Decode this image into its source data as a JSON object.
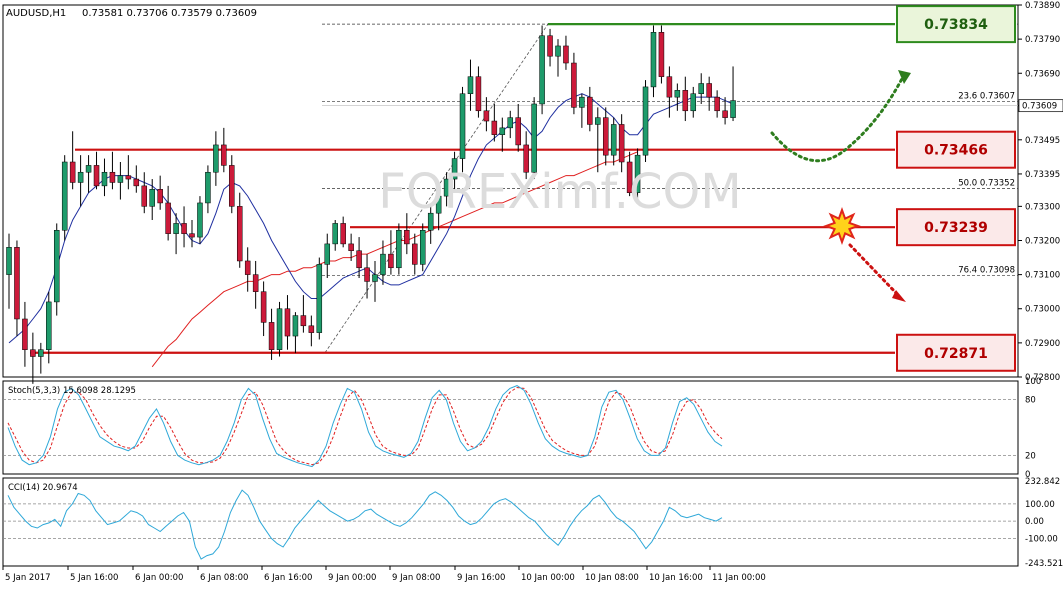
{
  "header": {
    "symbol": "AUDUSD,H1",
    "ohlc": "0.73581 0.73706 0.73579 0.73609"
  },
  "watermark": "FOREXimf.COM",
  "chart_data": [
    {
      "type": "candlestick",
      "ylim": [
        0.728,
        0.7389
      ],
      "y_ticks": [
        "0.73890",
        "0.73790",
        "0.73690",
        "0.73595",
        "0.73495",
        "0.73395",
        "0.73300",
        "0.73200",
        "0.73100",
        "0.73000",
        "0.72900",
        "0.72800"
      ],
      "current_price": "0.73609",
      "x_labels": [
        "5 Jan 2017",
        "5 Jan 16:00",
        "6 Jan 00:00",
        "6 Jan 08:00",
        "6 Jan 16:00",
        "9 Jan 00:00",
        "9 Jan 08:00",
        "9 Jan 16:00",
        "10 Jan 00:00",
        "10 Jan 08:00",
        "10 Jan 16:00",
        "11 Jan 00:00"
      ],
      "candles": [
        [
          0.731,
          0.7322,
          0.73,
          0.7318
        ],
        [
          0.7318,
          0.732,
          0.7292,
          0.7297
        ],
        [
          0.7297,
          0.7302,
          0.7283,
          0.7288
        ],
        [
          0.7288,
          0.7293,
          0.7278,
          0.7286
        ],
        [
          0.7286,
          0.729,
          0.7281,
          0.7288
        ],
        [
          0.7288,
          0.7305,
          0.7284,
          0.7302
        ],
        [
          0.7302,
          0.7325,
          0.7298,
          0.7323
        ],
        [
          0.7323,
          0.7345,
          0.732,
          0.7343
        ],
        [
          0.7343,
          0.7352,
          0.7335,
          0.7337
        ],
        [
          0.7337,
          0.7345,
          0.733,
          0.734
        ],
        [
          0.734,
          0.7345,
          0.7334,
          0.7342
        ],
        [
          0.7342,
          0.7346,
          0.7335,
          0.7336
        ],
        [
          0.7336,
          0.7344,
          0.7333,
          0.734
        ],
        [
          0.734,
          0.7346,
          0.7335,
          0.7337
        ],
        [
          0.7337,
          0.7343,
          0.7332,
          0.7339
        ],
        [
          0.7339,
          0.7345,
          0.7335,
          0.7338
        ],
        [
          0.7338,
          0.7342,
          0.7334,
          0.7336
        ],
        [
          0.7336,
          0.734,
          0.7328,
          0.733
        ],
        [
          0.733,
          0.7338,
          0.7326,
          0.7335
        ],
        [
          0.7335,
          0.7339,
          0.7329,
          0.7331
        ],
        [
          0.7331,
          0.7336,
          0.732,
          0.7322
        ],
        [
          0.7322,
          0.7328,
          0.7316,
          0.7325
        ],
        [
          0.7325,
          0.733,
          0.7318,
          0.7322
        ],
        [
          0.7322,
          0.7326,
          0.7318,
          0.7321
        ],
        [
          0.7321,
          0.7333,
          0.7319,
          0.7331
        ],
        [
          0.7331,
          0.7342,
          0.7328,
          0.734
        ],
        [
          0.734,
          0.7352,
          0.7336,
          0.7348
        ],
        [
          0.7348,
          0.7353,
          0.734,
          0.7342
        ],
        [
          0.7342,
          0.7345,
          0.7328,
          0.733
        ],
        [
          0.733,
          0.7334,
          0.7312,
          0.7314
        ],
        [
          0.7314,
          0.7318,
          0.7305,
          0.731
        ],
        [
          0.731,
          0.7314,
          0.73,
          0.7305
        ],
        [
          0.7305,
          0.7308,
          0.7292,
          0.7296
        ],
        [
          0.7296,
          0.73,
          0.7285,
          0.7288
        ],
        [
          0.7288,
          0.7302,
          0.7286,
          0.73
        ],
        [
          0.73,
          0.7304,
          0.7288,
          0.7292
        ],
        [
          0.7292,
          0.7299,
          0.7287,
          0.7298
        ],
        [
          0.7298,
          0.7304,
          0.7293,
          0.7295
        ],
        [
          0.7295,
          0.7298,
          0.7289,
          0.7293
        ],
        [
          0.7293,
          0.7315,
          0.7291,
          0.7313
        ],
        [
          0.7313,
          0.7322,
          0.7309,
          0.7319
        ],
        [
          0.7319,
          0.7326,
          0.7317,
          0.7325
        ],
        [
          0.7325,
          0.7327,
          0.7318,
          0.7319
        ],
        [
          0.7319,
          0.7322,
          0.7314,
          0.7317
        ],
        [
          0.7317,
          0.7321,
          0.7309,
          0.7312
        ],
        [
          0.7312,
          0.7316,
          0.7303,
          0.7308
        ],
        [
          0.7308,
          0.7314,
          0.7302,
          0.731
        ],
        [
          0.731,
          0.732,
          0.7307,
          0.7316
        ],
        [
          0.7316,
          0.7323,
          0.731,
          0.7312
        ],
        [
          0.7312,
          0.7325,
          0.731,
          0.7323
        ],
        [
          0.7323,
          0.7328,
          0.7316,
          0.7319
        ],
        [
          0.7319,
          0.7322,
          0.731,
          0.7313
        ],
        [
          0.7313,
          0.7325,
          0.7311,
          0.7323
        ],
        [
          0.7323,
          0.733,
          0.7319,
          0.7328
        ],
        [
          0.7328,
          0.7335,
          0.7323,
          0.7333
        ],
        [
          0.7333,
          0.734,
          0.733,
          0.7338
        ],
        [
          0.7338,
          0.7346,
          0.7335,
          0.7344
        ],
        [
          0.7344,
          0.7365,
          0.734,
          0.7363
        ],
        [
          0.7363,
          0.7373,
          0.7358,
          0.7368
        ],
        [
          0.7368,
          0.7371,
          0.7356,
          0.7358
        ],
        [
          0.7358,
          0.7362,
          0.7352,
          0.7355
        ],
        [
          0.7355,
          0.736,
          0.7349,
          0.7351
        ],
        [
          0.7351,
          0.7356,
          0.7346,
          0.7353
        ],
        [
          0.7353,
          0.7358,
          0.735,
          0.7356
        ],
        [
          0.7356,
          0.736,
          0.7346,
          0.7348
        ],
        [
          0.7348,
          0.7352,
          0.7338,
          0.734
        ],
        [
          0.734,
          0.7362,
          0.7338,
          0.736
        ],
        [
          0.736,
          0.7383,
          0.7357,
          0.738
        ],
        [
          0.738,
          0.7382,
          0.7371,
          0.7374
        ],
        [
          0.7374,
          0.7379,
          0.7368,
          0.7377
        ],
        [
          0.7377,
          0.738,
          0.737,
          0.7372
        ],
        [
          0.7372,
          0.7375,
          0.7357,
          0.7359
        ],
        [
          0.7359,
          0.7363,
          0.7353,
          0.7362
        ],
        [
          0.7362,
          0.7365,
          0.7352,
          0.7354
        ],
        [
          0.7354,
          0.7359,
          0.734,
          0.7356
        ],
        [
          0.7356,
          0.7359,
          0.7342,
          0.7345
        ],
        [
          0.7345,
          0.7356,
          0.7342,
          0.7354
        ],
        [
          0.7354,
          0.7357,
          0.734,
          0.7343
        ],
        [
          0.7343,
          0.7346,
          0.7333,
          0.7334
        ],
        [
          0.7334,
          0.7347,
          0.7331,
          0.7345
        ],
        [
          0.7345,
          0.7367,
          0.7343,
          0.7365
        ],
        [
          0.7365,
          0.7383,
          0.7362,
          0.7381
        ],
        [
          0.7381,
          0.7383,
          0.7366,
          0.7368
        ],
        [
          0.7368,
          0.7371,
          0.7356,
          0.7362
        ],
        [
          0.7362,
          0.7366,
          0.7358,
          0.7364
        ],
        [
          0.7364,
          0.7368,
          0.7355,
          0.7358
        ],
        [
          0.7358,
          0.7365,
          0.7356,
          0.7363
        ],
        [
          0.7363,
          0.7369,
          0.736,
          0.7366
        ],
        [
          0.7366,
          0.7368,
          0.7358,
          0.7362
        ],
        [
          0.7362,
          0.7364,
          0.7356,
          0.7358
        ],
        [
          0.7358,
          0.7362,
          0.7354,
          0.7356
        ],
        [
          0.7356,
          0.7371,
          0.7355,
          0.7361
        ]
      ],
      "ma_blue": [
        0.729,
        0.7292,
        0.7294,
        0.7297,
        0.73,
        0.7305,
        0.7312,
        0.732,
        0.7326,
        0.733,
        0.7334,
        0.7336,
        0.7338,
        0.7339,
        0.7339,
        0.7339,
        0.7338,
        0.7337,
        0.7336,
        0.7334,
        0.7331,
        0.7327,
        0.7323,
        0.732,
        0.7319,
        0.7322,
        0.7328,
        0.7335,
        0.7337,
        0.7336,
        0.7333,
        0.7329,
        0.7325,
        0.732,
        0.7316,
        0.7312,
        0.7308,
        0.7305,
        0.7303,
        0.7303,
        0.7305,
        0.7307,
        0.7309,
        0.731,
        0.7311,
        0.7312,
        0.731,
        0.7308,
        0.7307,
        0.7307,
        0.7308,
        0.7309,
        0.731,
        0.7314,
        0.7318,
        0.7322,
        0.7327,
        0.7333,
        0.7339,
        0.7344,
        0.7348,
        0.735,
        0.7352,
        0.7354,
        0.7355,
        0.7353,
        0.735,
        0.7352,
        0.7356,
        0.7359,
        0.7361,
        0.7362,
        0.7363,
        0.7362,
        0.736,
        0.7358,
        0.7356,
        0.7353,
        0.7351,
        0.7351,
        0.7354,
        0.7357,
        0.7358,
        0.7359,
        0.736,
        0.7361,
        0.7362,
        0.7362,
        0.7362,
        0.7362,
        0.7361,
        0.736
      ],
      "ma_red": [
        null,
        null,
        null,
        null,
        null,
        null,
        null,
        null,
        null,
        null,
        null,
        null,
        null,
        null,
        null,
        null,
        null,
        null,
        0.7283,
        0.7286,
        0.7289,
        0.7291,
        0.7294,
        0.7297,
        0.7299,
        0.7301,
        0.7303,
        0.7305,
        0.7306,
        0.7307,
        0.7308,
        0.7308,
        0.7309,
        0.731,
        0.731,
        0.7311,
        0.7311,
        0.7312,
        0.7312,
        0.7313,
        0.7314,
        0.7314,
        0.7315,
        0.7315,
        0.7316,
        0.7316,
        0.7317,
        0.7318,
        0.7319,
        0.732,
        0.732,
        0.7321,
        0.7322,
        0.7323,
        0.7324,
        0.7325,
        0.7326,
        0.7327,
        0.7328,
        0.7329,
        0.733,
        0.7331,
        0.7331,
        0.7332,
        0.7333,
        0.7334,
        0.7335,
        0.7336,
        0.7337,
        0.7338,
        0.7339,
        0.7339,
        0.734,
        0.7341,
        0.7342,
        0.7343,
        0.7343,
        0.7344,
        0.7345,
        0.7346
      ],
      "levels": [
        {
          "label": "0.73834",
          "value": 0.73834,
          "color": "#2e8b1e"
        },
        {
          "label": "0.73466",
          "value": 0.73466,
          "color": "#cc1111"
        },
        {
          "label": "0.73239",
          "value": 0.73239,
          "color": "#cc1111"
        },
        {
          "label": "0.72871",
          "value": 0.72871,
          "color": "#cc1111"
        }
      ],
      "fib": [
        {
          "label": "23.6 0.73607",
          "value": 0.73607
        },
        {
          "label": "50.0 0.73352",
          "value": 0.73352
        },
        {
          "label": "76.4 0.73098",
          "value": 0.73098
        }
      ]
    },
    {
      "type": "line",
      "name": "Stoch(5,3,3) 15.6098 28.1295",
      "ylim": [
        0,
        100
      ],
      "y_ticks": [
        "100",
        "80",
        "20",
        "0"
      ],
      "k": [
        50,
        30,
        15,
        10,
        12,
        20,
        40,
        70,
        88,
        92,
        85,
        70,
        55,
        40,
        35,
        30,
        28,
        25,
        30,
        45,
        60,
        70,
        55,
        35,
        20,
        15,
        12,
        10,
        12,
        15,
        20,
        35,
        55,
        80,
        92,
        85,
        60,
        38,
        22,
        18,
        15,
        12,
        10,
        8,
        15,
        30,
        55,
        75,
        92,
        88,
        70,
        45,
        30,
        25,
        22,
        20,
        18,
        22,
        35,
        60,
        82,
        90,
        80,
        55,
        35,
        25,
        28,
        35,
        50,
        70,
        85,
        92,
        95,
        90,
        75,
        55,
        38,
        30,
        25,
        22,
        20,
        18,
        20,
        40,
        72,
        88,
        90,
        80,
        60,
        38,
        25,
        20,
        20,
        28,
        55,
        78,
        82,
        75,
        60,
        45,
        35,
        30
      ],
      "d": [
        55,
        40,
        25,
        15,
        12,
        15,
        28,
        52,
        75,
        88,
        88,
        80,
        65,
        52,
        42,
        35,
        30,
        28,
        28,
        35,
        50,
        62,
        62,
        50,
        35,
        22,
        15,
        12,
        12,
        13,
        17,
        28,
        45,
        65,
        85,
        88,
        75,
        55,
        35,
        25,
        18,
        14,
        12,
        10,
        12,
        22,
        40,
        62,
        82,
        90,
        80,
        62,
        42,
        30,
        25,
        22,
        20,
        20,
        28,
        48,
        70,
        85,
        85,
        68,
        48,
        32,
        28,
        32,
        42,
        60,
        77,
        88,
        93,
        92,
        82,
        65,
        48,
        36,
        30,
        25,
        22,
        20,
        20,
        30,
        55,
        78,
        88,
        85,
        72,
        52,
        35,
        25,
        22,
        25,
        42,
        65,
        78,
        80,
        70,
        55,
        45,
        38
      ]
    },
    {
      "type": "line",
      "name": "CCI(14) 20.9674",
      "ylim": [
        -260,
        250
      ],
      "y_ticks": [
        "232.842",
        "100.00",
        "0.00",
        "-100.00",
        "-243.5213"
      ],
      "values": [
        150,
        80,
        40,
        0,
        -30,
        -40,
        -20,
        -10,
        10,
        -30,
        60,
        100,
        160,
        150,
        120,
        60,
        20,
        -20,
        -10,
        0,
        30,
        60,
        50,
        30,
        -20,
        -40,
        -60,
        -30,
        0,
        30,
        50,
        0,
        -150,
        -220,
        -200,
        -190,
        -150,
        -60,
        50,
        120,
        180,
        150,
        80,
        0,
        -50,
        -100,
        -130,
        -150,
        -100,
        -40,
        0,
        40,
        80,
        120,
        90,
        60,
        40,
        20,
        0,
        10,
        30,
        60,
        70,
        40,
        20,
        0,
        -20,
        -30,
        -10,
        20,
        60,
        100,
        150,
        170,
        150,
        120,
        80,
        30,
        0,
        -20,
        -10,
        20,
        60,
        100,
        120,
        130,
        110,
        80,
        50,
        20,
        0,
        -40,
        -80,
        -110,
        -140,
        -90,
        -30,
        20,
        60,
        90,
        130,
        150,
        110,
        60,
        20,
        0,
        -30,
        -60,
        -110,
        -160,
        -120,
        -60,
        0,
        80,
        60,
        30,
        20,
        30,
        40,
        20,
        10,
        0,
        20
      ]
    }
  ]
}
